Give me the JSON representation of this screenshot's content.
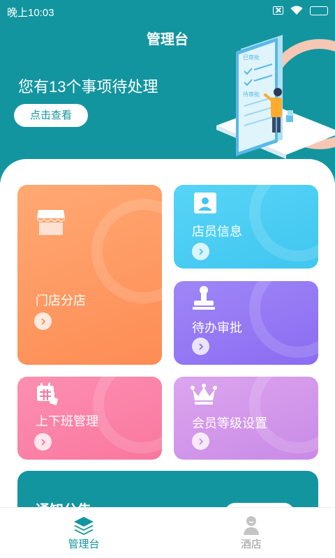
{
  "status_bar": {
    "time": "晚上10:03"
  },
  "header": {
    "title": "管理台",
    "pending_text": "您有13个事项待处理",
    "view_button": "点击查看",
    "illustration": {
      "tag_approved": "已审批",
      "tag_pending": "待审批"
    }
  },
  "cards": {
    "store": {
      "label": "门店分店",
      "icon": "storefront-icon"
    },
    "staff": {
      "label": "店员信息",
      "icon": "id-card-icon"
    },
    "approval": {
      "label": "待办审批",
      "icon": "stamp-icon"
    },
    "shift": {
      "label": "上下班管理",
      "icon": "calendar-icon"
    },
    "member": {
      "label": "会员等级设置",
      "icon": "crown-icon"
    }
  },
  "notice": {
    "title": "通知公告"
  },
  "tabbar": {
    "items": [
      {
        "label": "管理台",
        "icon": "layers-icon",
        "active": true
      },
      {
        "label": "酒店",
        "icon": "user-icon",
        "active": false
      }
    ]
  },
  "colors": {
    "brand": "#13959f",
    "tab_active": "#13959f",
    "tab_inactive": "#999999"
  }
}
